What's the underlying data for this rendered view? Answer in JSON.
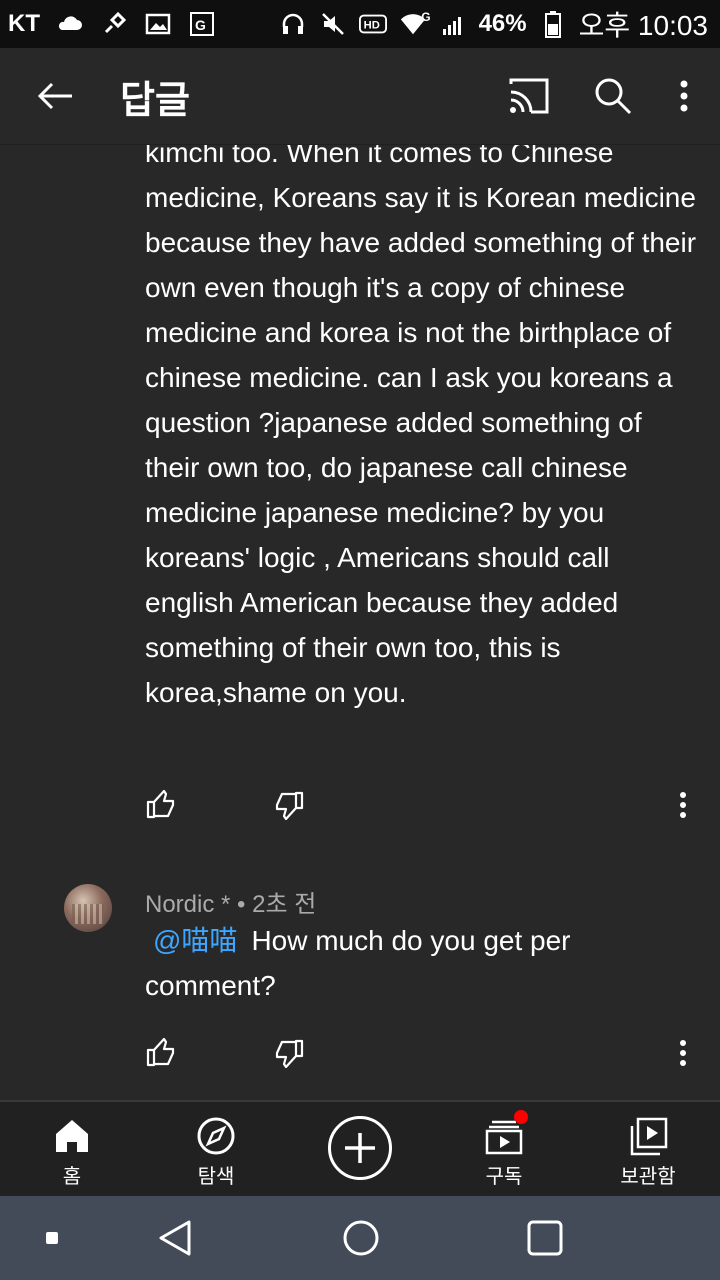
{
  "status_bar": {
    "carrier": "KT",
    "battery_percent": "46%",
    "time": "오후 10:03",
    "icons": [
      "cloud-icon",
      "pin-icon",
      "image-icon",
      "translate-icon",
      "headset-icon",
      "mute-icon",
      "hd-icon",
      "wifi-icon",
      "signal-icon",
      "battery-icon"
    ],
    "signal_badge": "G"
  },
  "app_bar": {
    "title": "답글",
    "icons": [
      "back-arrow-icon",
      "cast-icon",
      "search-icon",
      "more-vert-icon"
    ]
  },
  "comments": [
    {
      "text": "kimchi too. When it comes to Chinese medicine, Koreans say it is Korean medicine because they have added something of their own even though it's a copy of chinese medicine and korea is not the birthplace of chinese medicine. can I ask you koreans a question ?japanese added something of their own too, do japanese call chinese medicine japanese medicine? by you koreans' logic , Americans should call english American because they added something of their own too, this is korea,shame on you."
    },
    {
      "author": "Nordic *",
      "separator": "•",
      "time": "2초 전",
      "mention": "@喵喵",
      "text": "How much do you get per comment?"
    }
  ],
  "bottom_nav": {
    "items": [
      {
        "label": "홈",
        "icon": "home-icon"
      },
      {
        "label": "탐색",
        "icon": "compass-icon"
      },
      {
        "label": "",
        "icon": "create-plus-icon"
      },
      {
        "label": "구독",
        "icon": "subscriptions-icon"
      },
      {
        "label": "보관함",
        "icon": "library-icon"
      }
    ],
    "colors": {
      "notification_dot": "#ff0000",
      "mention": "#3ea6ff"
    }
  },
  "system_nav": {
    "icons": [
      "recent-square-small-icon",
      "back-triangle-icon",
      "home-circle-icon",
      "overview-square-icon"
    ]
  }
}
